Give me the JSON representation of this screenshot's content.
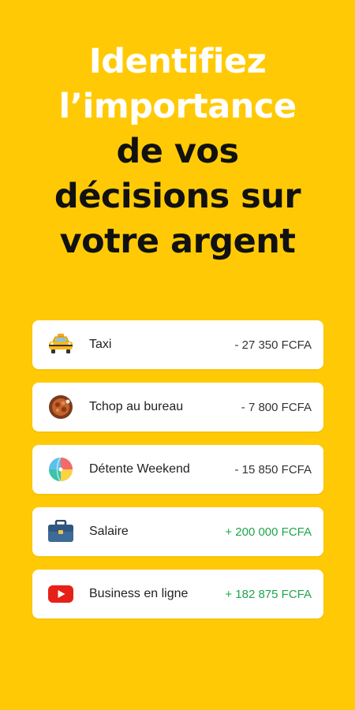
{
  "headline": {
    "line1": "Identifiez",
    "line2": "l’importance",
    "line3": "de vos",
    "line4": "décisions sur",
    "line5": "votre argent"
  },
  "transactions": [
    {
      "label": "Taxi",
      "amount": "- 27 350 FCFA",
      "icon": "taxi-icon"
    },
    {
      "label": "Tchop au bureau",
      "amount": "- 7 800 FCFA",
      "icon": "food-plate-icon"
    },
    {
      "label": "Détente Weekend",
      "amount": "- 15 850 FCFA",
      "icon": "beach-ball-icon"
    },
    {
      "label": "Salaire",
      "amount": "+ 200 000 FCFA",
      "icon": "briefcase-icon"
    },
    {
      "label": "Business en ligne",
      "amount": "+ 182 875 FCFA",
      "icon": "youtube-icon"
    }
  ],
  "colors": {
    "background": "#FFCA05",
    "positive_amount": "#1EA64A",
    "negative_amount": "#333333"
  }
}
